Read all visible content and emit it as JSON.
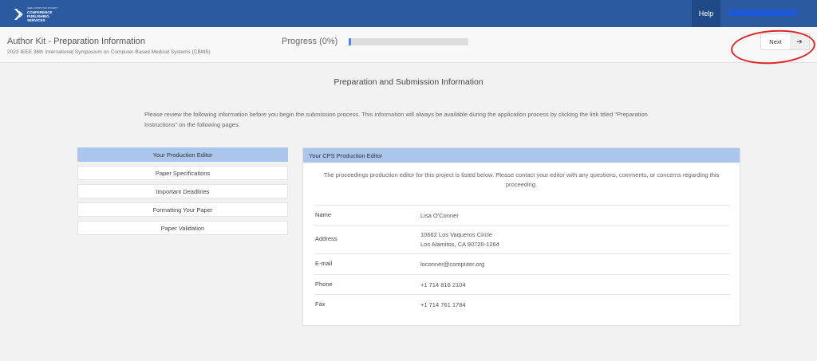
{
  "topbar": {
    "logo_line1": "IEEE COMPUTER SOCIETY",
    "logo_line2": "CONFERENCE",
    "logo_line3": "PUBLISHING",
    "logo_line4": "SERVICES",
    "help_label": "Help",
    "colors": {
      "bar": "#2b5aa0",
      "help_bg": "#1f4a86"
    }
  },
  "subheader": {
    "title": "Author Kit - Preparation Information",
    "conference": "2023 IEEE 36th International Symposium on Computer-Based Medical Systems (CBMS)",
    "progress_label": "Progress (0%)",
    "progress_value": 0.02,
    "next_label": "Next",
    "next_icon": "arrow-right-icon"
  },
  "main": {
    "heading": "Preparation and Submission Information",
    "intro": "Please review the following information before you begin the submission process. This information will always be available during the application process by clicking the link titled \"Preparation Instructions\" on the following pages."
  },
  "sidebar": {
    "items": [
      {
        "label": "Your Production Editor",
        "active": true
      },
      {
        "label": "Paper Specifications",
        "active": false
      },
      {
        "label": "Important Deadlines",
        "active": false
      },
      {
        "label": "Formatting Your Paper",
        "active": false
      },
      {
        "label": "Paper Validation",
        "active": false
      }
    ]
  },
  "panel": {
    "header": "Your CPS Production Editor",
    "intro": "The proceedings production editor for this project is listed below. Please contact your editor with any questions, comments, or concerns regarding this proceeding.",
    "rows": [
      {
        "key": "Name",
        "value": "Lisa O'Conner",
        "value2": ""
      },
      {
        "key": "Address",
        "value": "10662 Los Vaqueros Circle",
        "value2": "Los Alamitos, CA 90720-1264"
      },
      {
        "key": "E-mail",
        "value": "loconner@computer.org",
        "value2": ""
      },
      {
        "key": "Phone",
        "value": "+1 714 816 2104",
        "value2": ""
      },
      {
        "key": "Fax",
        "value": "+1 714 761 1784",
        "value2": ""
      }
    ]
  },
  "colors": {
    "accent": "#aac6ec",
    "progress": "#4a8ae8",
    "annotation": "#e0262b"
  }
}
